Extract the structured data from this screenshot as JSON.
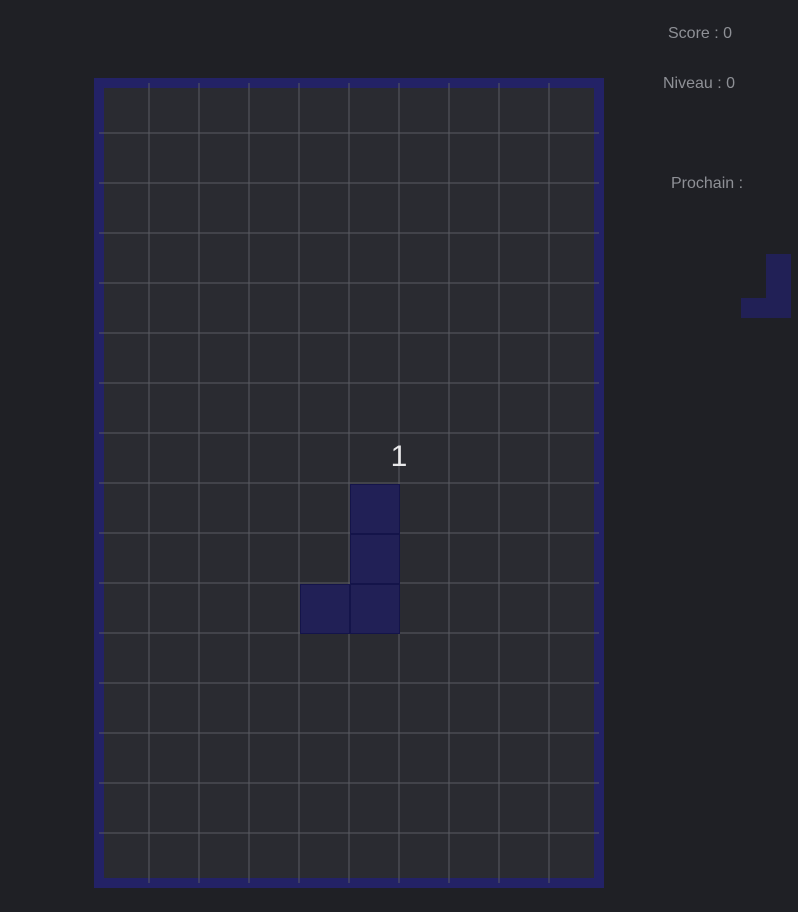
{
  "hud": {
    "score_label": "Score : 0",
    "level_label": "Niveau : 0",
    "next_label": "Prochain :"
  },
  "board": {
    "columns": 10,
    "rows": 16,
    "countdown": "1"
  },
  "current_piece": {
    "type": "J",
    "color": "#212056",
    "cells": [
      [
        5,
        8
      ],
      [
        5,
        9
      ],
      [
        4,
        10
      ],
      [
        5,
        10
      ]
    ]
  },
  "next_piece": {
    "type": "J",
    "color": "#212056"
  },
  "colors": {
    "background": "#1f2025",
    "board_fill": "#2a2b31",
    "board_border": "#232266",
    "grid_line": "#5a5b62",
    "hud_text": "#8e9096",
    "countdown_text": "#e8e8ea"
  }
}
